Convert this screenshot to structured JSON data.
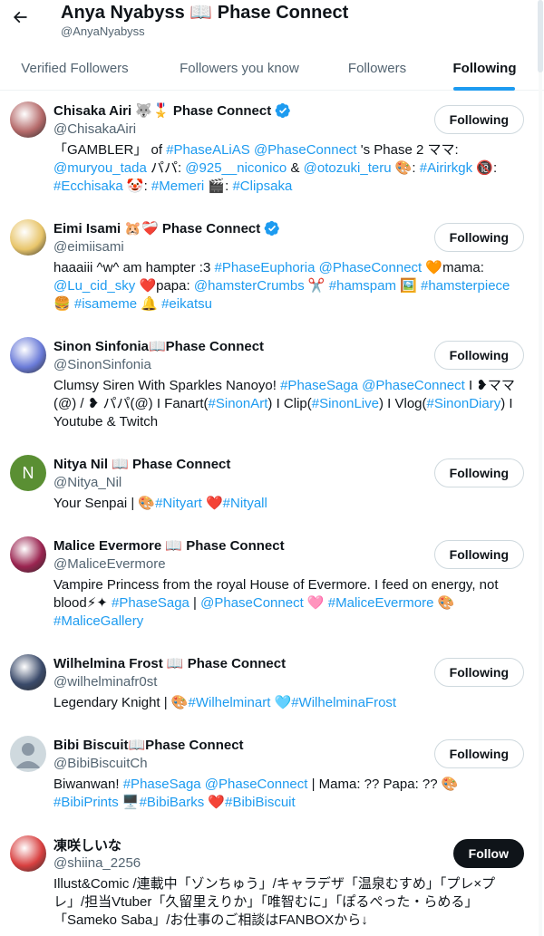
{
  "header": {
    "title": "Anya Nyabyss 📖 Phase Connect",
    "handle": "@AnyaNyabyss"
  },
  "tabs": [
    {
      "label": "Verified Followers",
      "active": false
    },
    {
      "label": "Followers you know",
      "active": false
    },
    {
      "label": "Followers",
      "active": false
    },
    {
      "label": "Following",
      "active": true
    }
  ],
  "users": [
    {
      "name": "Chisaka Airi 🐺🎖️ Phase Connect",
      "handle": "@ChisakaAiri",
      "verified": true,
      "button": "Following",
      "avatar_color": "#b56a6a",
      "bio": [
        [
          [
            "「GAMBLER」 of ",
            0
          ],
          [
            "#PhaseALiAS",
            1
          ],
          [
            " ",
            0
          ],
          [
            "@PhaseConnect",
            1
          ],
          [
            " 's Phase 2 ママ:",
            0
          ]
        ],
        [
          [
            "@muryou_tada",
            1
          ],
          [
            " パパ: ",
            0
          ],
          [
            "@925__niconico",
            1
          ],
          [
            " & ",
            0
          ],
          [
            "@otozuki_teru",
            1
          ],
          [
            " 🎨: ",
            0
          ],
          [
            "#Airirkgk",
            1
          ],
          [
            " 🔞:",
            0
          ]
        ],
        [
          [
            "#Ecchisaka",
            1
          ],
          [
            " 🤡: ",
            0
          ],
          [
            "#Memeri",
            1
          ],
          [
            " 🎬: ",
            0
          ],
          [
            "#Clipsaka",
            1
          ]
        ]
      ]
    },
    {
      "name": "Eimi Isami 🐹❤️‍🩹 Phase Connect",
      "handle": "@eimiisami",
      "verified": true,
      "button": "Following",
      "avatar_color": "#e8c56a",
      "bio": [
        [
          [
            "haaaiii ^w^ am hampter :3 ",
            0
          ],
          [
            "#PhaseEuphoria",
            1
          ],
          [
            " ",
            0
          ],
          [
            "@PhaseConnect",
            1
          ],
          [
            " 🧡mama:",
            0
          ]
        ],
        [
          [
            "@Lu_cid_sky",
            1
          ],
          [
            " ❤️papa: ",
            0
          ],
          [
            "@hamsterCrumbs",
            1
          ],
          [
            " ✂️ ",
            0
          ],
          [
            "#hamspam",
            1
          ],
          [
            " 🖼️ ",
            0
          ],
          [
            "#hamsterpiece",
            1
          ]
        ],
        [
          [
            "🍔 ",
            0
          ],
          [
            "#isameme",
            1
          ],
          [
            " 🔔 ",
            0
          ],
          [
            "#eikatsu",
            1
          ]
        ]
      ]
    },
    {
      "name": "Sinon Sinfonia📖Phase Connect",
      "handle": "@SinonSinfonia",
      "verified": false,
      "button": "Following",
      "avatar_color": "#6a7bd8",
      "bio": [
        [
          [
            "Clumsy Siren With Sparkles Nanoyo! ",
            0
          ],
          [
            "#PhaseSaga",
            1
          ],
          [
            " ",
            0
          ],
          [
            "@PhaseConnect",
            1
          ],
          [
            " I ❥ママ",
            0
          ]
        ],
        [
          [
            "(@) / ❥ パパ(@) I Fanart(",
            0
          ],
          [
            "#SinonArt",
            1
          ],
          [
            ") I Clip(",
            0
          ],
          [
            "#SinonLive",
            1
          ],
          [
            ") I Vlog(",
            0
          ],
          [
            "#SinonDiary",
            1
          ],
          [
            ") I",
            0
          ]
        ],
        [
          [
            "Youtube & Twitch",
            0
          ]
        ]
      ]
    },
    {
      "name": "Nitya Nil 📖 Phase Connect",
      "handle": "@Nitya_Nil",
      "verified": false,
      "button": "Following",
      "avatar_color": "#5a8f33",
      "avatar_letter": "N",
      "bio": [
        [
          [
            "Your Senpai | 🎨",
            0
          ],
          [
            "#Nityart",
            1
          ],
          [
            " ❤️",
            0
          ],
          [
            "#Nityall",
            1
          ]
        ]
      ]
    },
    {
      "name": "Malice Evermore 📖 Phase Connect",
      "handle": "@MaliceEvermore",
      "verified": false,
      "button": "Following",
      "avatar_color": "#9a2450",
      "bio": [
        [
          [
            "Vampire Princess from the royal House of Evermore. I feed on energy, not",
            0
          ]
        ],
        [
          [
            "blood⚡✦ ",
            0
          ],
          [
            "#PhaseSaga",
            1
          ],
          [
            " | ",
            0
          ],
          [
            "@PhaseConnect",
            1
          ],
          [
            " 🩷 ",
            0
          ],
          [
            "#MaliceEvermore",
            1
          ],
          [
            " 🎨",
            0
          ]
        ],
        [
          [
            "#MaliceGallery",
            1
          ]
        ]
      ]
    },
    {
      "name": "Wilhelmina Frost 📖 Phase Connect",
      "handle": "@wilhelminafr0st",
      "verified": false,
      "button": "Following",
      "avatar_color": "#3a4a6a",
      "bio": [
        [
          [
            "Legendary Knight | 🎨",
            0
          ],
          [
            "#Wilhelminart",
            1
          ],
          [
            " 🩵",
            0
          ],
          [
            "#WilhelminaFrost",
            1
          ]
        ]
      ]
    },
    {
      "name": "Bibi Biscuit📖Phase Connect",
      "handle": "@BibiBiscuitCh",
      "verified": false,
      "button": "Following",
      "avatar_color": "#cfd9de",
      "default_avatar": true,
      "bio": [
        [
          [
            "Biwanwan! ",
            0
          ],
          [
            "#PhaseSaga",
            1
          ],
          [
            " ",
            0
          ],
          [
            "@PhaseConnect",
            1
          ],
          [
            " | Mama: ?? Papa: ?? 🎨",
            0
          ]
        ],
        [
          [
            "#BibiPrints",
            1
          ],
          [
            " 🖥️",
            0
          ],
          [
            "#BibiBarks",
            1
          ],
          [
            " ❤️",
            0
          ],
          [
            "#BibiBiscuit",
            1
          ]
        ]
      ]
    },
    {
      "name": "凍咲しいな",
      "handle": "@shiina_2256",
      "verified": false,
      "button": "Follow",
      "avatar_color": "#d84040",
      "bio": [
        [
          [
            "Illust&Comic /連載中「ゾンちゅう」/キャラデザ「温泉むすめ」「プレ×プ",
            0
          ]
        ],
        [
          [
            "レ」/担当Vtuber「久留里えりか」「唯智むに」「ぽるぺった・らめる」",
            0
          ]
        ],
        [
          [
            "「Sameko Saba」/お仕事のご相談はFANBOXから↓",
            0
          ]
        ]
      ]
    }
  ]
}
